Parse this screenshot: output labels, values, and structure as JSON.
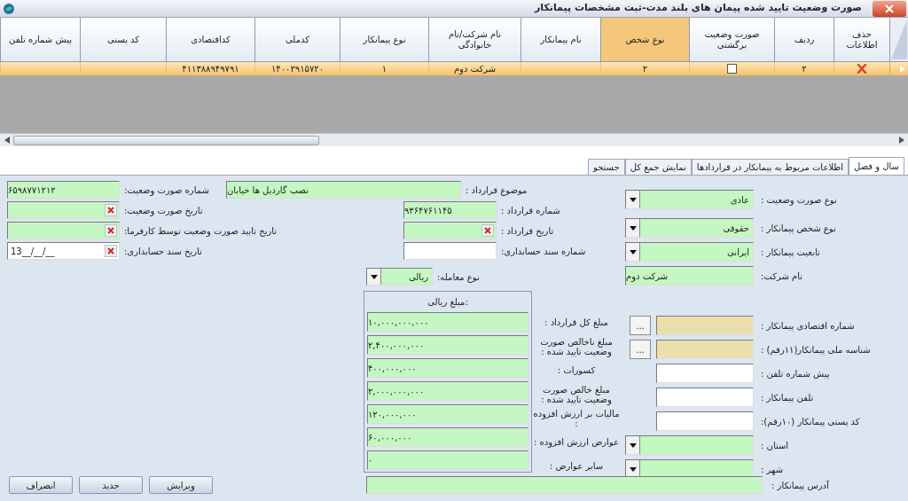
{
  "window": {
    "title": "صورت وضعیت تایید شده پیمان های بلند مدت-ثبت مشخصات پیمانکار"
  },
  "table": {
    "columns": [
      {
        "label": "حذف اطلاعات",
        "selected": false
      },
      {
        "label": "ردیف",
        "selected": false
      },
      {
        "label": "صورت وضعیت برگشتی",
        "selected": false
      },
      {
        "label": "نوع شخص",
        "selected": true
      },
      {
        "label": "نام پیمانکار",
        "selected": false
      },
      {
        "label": "نام شرکت/نام خانوادگی",
        "selected": false
      },
      {
        "label": "نوع پیمانکار",
        "selected": false
      },
      {
        "label": "کدملی",
        "selected": false
      },
      {
        "label": "کداقتصادی",
        "selected": false
      },
      {
        "label": "کد پستی",
        "selected": false
      },
      {
        "label": "پیش شماره تلفن",
        "selected": false
      }
    ],
    "rows": [
      {
        "selected": true,
        "cells": [
          {
            "kind": "delete"
          },
          {
            "kind": "text",
            "text": "۲"
          },
          {
            "kind": "check",
            "checked": false
          },
          {
            "kind": "text",
            "text": "۲"
          },
          {
            "kind": "text"
          },
          {
            "kind": "text",
            "text": "شرکت دوم"
          },
          {
            "kind": "text",
            "text": "۱"
          },
          {
            "kind": "text",
            "text": "۱۴۰۰۲۹۱۵۷۲۰"
          },
          {
            "kind": "text",
            "text": "۴۱۱۳۸۸۹۴۹۷۹۱"
          },
          {
            "kind": "text"
          },
          {
            "kind": "text"
          }
        ]
      }
    ]
  },
  "tabs": [
    {
      "label": "سال و فصل",
      "selected": true
    },
    {
      "label": "اطلاعات مربوط به پیمانکار در قراردادها",
      "selected": false
    },
    {
      "label": "نمایش جمع کل",
      "selected": false
    },
    {
      "label": "جستجو",
      "selected": false
    }
  ],
  "form": {
    "contractor_fields": [
      {
        "label": "نوع صورت وضعیت :",
        "kind": "select",
        "value": "عادی",
        "required": true
      },
      {
        "label": "نوع شخص پیمانکار :",
        "kind": "select",
        "value": "حقوقی",
        "required": true
      },
      {
        "label": "تابعیت پیمانکار :",
        "kind": "select",
        "value": "ایرانی",
        "required": true
      },
      {
        "label": "نام شرکت:",
        "kind": "text",
        "value": "شرکت دوم",
        "required": true
      },
      {
        "label": "شماره اقتصادی پیمانکار :",
        "kind": "lookup",
        "button": "..."
      },
      {
        "label": "شناسه ملی پیمانکار(۱۱رقم) :",
        "kind": "lookup",
        "button": "..."
      },
      {
        "label": "پیش شماره تلفن :",
        "kind": "text",
        "required": false
      },
      {
        "label": "تلفن پیمانکار :",
        "kind": "text",
        "required": false
      },
      {
        "label": "کد پستی پیمانکار (۱۰رقم):",
        "kind": "text",
        "required": false
      },
      {
        "label": "استان :",
        "kind": "select",
        "required": true
      },
      {
        "label": "شهر :",
        "kind": "select",
        "required": true
      }
    ],
    "status_fields": [
      {
        "label": "شماره صورت وضعیت:",
        "kind": "text",
        "value": "۶۵۹۸۷۷۱۲۱۲",
        "required": true
      },
      {
        "label": "تاریخ صورت وضعیت:",
        "kind": "date",
        "required": true
      },
      {
        "label": "تاریخ تایید صورت وضعیت توسط کارفرما:",
        "kind": "date",
        "required": true
      },
      {
        "label": "تاریخ سند حسابداری:",
        "kind": "date",
        "value": "13__/__/__",
        "required": false
      }
    ],
    "contract_fields": [
      {
        "label": "موضوع قرارداد :",
        "kind": "text",
        "value": "نصب گاردیل ها خیابان",
        "required": true
      },
      {
        "label": "شماره قرارداد :",
        "kind": "text",
        "value": "۹۳۶۴۷۶۱۱۴۵",
        "required": true
      },
      {
        "label": "تاریخ قرارداد :",
        "kind": "date",
        "required": true
      },
      {
        "label": "شماره سند حسابداری:",
        "kind": "text",
        "required": false
      }
    ],
    "transaction_type": {
      "label": "نوع معامله:",
      "kind": "select",
      "value": "ریالی",
      "required": true
    },
    "amounts": {
      "title": "مبلغ ریالی:",
      "items": [
        {
          "label": "مبلغ کل قرارداد :",
          "value": "۱۰,۰۰۰,۰۰۰,۰۰۰",
          "required": true
        },
        {
          "label": "مبلغ ناخالص صورت وضعیت تایید شده :",
          "value": "۲,۴۰۰,۰۰۰,۰۰۰",
          "required": true
        },
        {
          "label": "کسورات :",
          "value": "۴۰۰,۰۰۰,۰۰۰",
          "required": true
        },
        {
          "label": "مبلغ خالص صورت وضعیت تایید شده :",
          "value": "۲,۰۰۰,۰۰۰,۰۰۰",
          "required": true
        },
        {
          "label": "مالیات بر ارزش افزوده :",
          "value": "۱۲۰,۰۰۰,۰۰۰",
          "required": true
        },
        {
          "label": "عوارض ارزش افزوده :",
          "value": "۶۰,۰۰۰,۰۰۰",
          "required": true
        },
        {
          "label": "سایر عوارض :",
          "value": "۰",
          "required": true
        }
      ]
    },
    "address": {
      "label": "آدرس پیمانکار :",
      "required": true
    }
  },
  "buttons": [
    {
      "label": "ویرایش"
    },
    {
      "label": "جدید"
    },
    {
      "label": "انصراف"
    }
  ]
}
